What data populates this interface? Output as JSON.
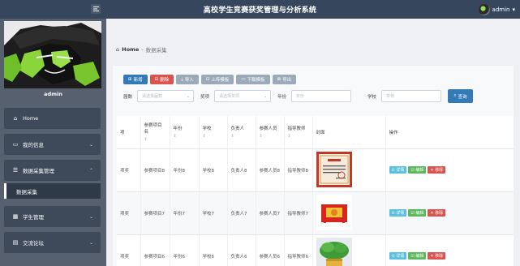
{
  "header": {
    "title": "高校学生竞赛获奖管理与分析系统",
    "username": "admin"
  },
  "sidebar": {
    "username": "admin",
    "items": [
      {
        "label": "Home",
        "icon": "home-icon"
      },
      {
        "label": "我的信息",
        "icon": "id-card-icon"
      },
      {
        "label": "数据采集管理",
        "icon": "sliders-icon"
      },
      {
        "label": "学生管理",
        "icon": "grid-icon"
      },
      {
        "label": "交流论坛",
        "icon": "clipboard-icon"
      }
    ],
    "sub_items": [
      {
        "label": "数据采集"
      }
    ]
  },
  "breadcrumb": {
    "home": "Home",
    "current": "数据采集"
  },
  "toolbar": {
    "add": "新增",
    "delete": "删除",
    "import": "导入",
    "upload_template": "上传模板",
    "download_template": "下载模板",
    "export": "导出"
  },
  "filters": {
    "term_label": "届数",
    "term_placeholder": "请选择届数",
    "award_label": "奖项",
    "award_placeholder": "请选择奖项",
    "year_label": "年份",
    "year_placeholder": "年份",
    "school_label": "学校",
    "school_placeholder": "学校",
    "query": "查询"
  },
  "table": {
    "headers": [
      "项",
      "参赛项目名",
      "年份",
      "学校",
      "负责人",
      "参赛人员",
      "指导教师",
      "封面",
      "操作"
    ],
    "rows": [
      {
        "award": "项奖",
        "project": "参赛项目8",
        "year": "年份8",
        "school": "学校8",
        "leader": "负责人8",
        "members": "参赛人员8",
        "teacher": "指导教师8",
        "cover": "certificate"
      },
      {
        "award": "项奖",
        "project": "参赛项目7",
        "year": "年份7",
        "school": "学校7",
        "leader": "负责人7",
        "members": "参赛人员7",
        "teacher": "指导教师7",
        "cover": "festival"
      },
      {
        "award": "项奖",
        "project": "参赛项目6",
        "year": "年份6",
        "school": "学校6",
        "leader": "负责人6",
        "members": "参赛人员6",
        "teacher": "指导教师6",
        "cover": "plant"
      }
    ],
    "actions": {
      "detail": "详情",
      "edit": "编辑",
      "remove": "移除"
    }
  },
  "colors": {
    "header": "#36465d",
    "sidebar": "#56606e",
    "primary": "#337ab7",
    "danger": "#d9534f",
    "success": "#5cb85c",
    "info": "#5bc0de"
  }
}
